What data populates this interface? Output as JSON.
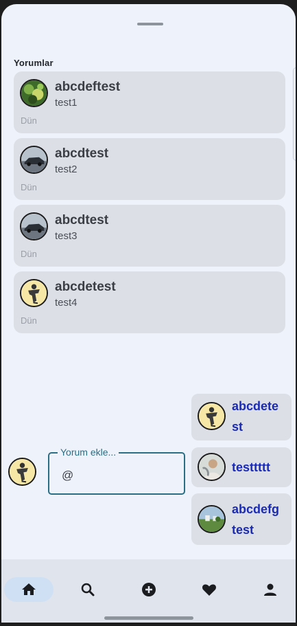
{
  "section_title": "Yorumlar",
  "comments": [
    {
      "user": "abcdeftest",
      "text": "test1",
      "time": "Dün",
      "avatar": "plant-avatar"
    },
    {
      "user": "abcdtest",
      "text": "test2",
      "time": "Dün",
      "avatar": "car-avatar"
    },
    {
      "user": "abcdtest",
      "text": "test3",
      "time": "Dün",
      "avatar": "car-avatar"
    },
    {
      "user": "abcdetest",
      "text": "test4",
      "time": "Dün",
      "avatar": "dancer-avatar"
    }
  ],
  "input": {
    "label": "Yorum ekle...",
    "value": "@"
  },
  "suggestions": [
    {
      "line1": "abcdete",
      "line2": "st",
      "avatar": "dancer-avatar"
    },
    {
      "line1": "testtttt",
      "line2": "",
      "avatar": "person-avatar"
    },
    {
      "line1": "abcdefg",
      "line2": "test",
      "avatar": "landscape-avatar"
    }
  ],
  "nav": [
    {
      "icon": "home-icon",
      "active": true
    },
    {
      "icon": "search-icon",
      "active": false
    },
    {
      "icon": "add-circle-icon",
      "active": false
    },
    {
      "icon": "heart-icon",
      "active": false
    },
    {
      "icon": "profile-icon",
      "active": false
    }
  ],
  "colors": {
    "accent": "#2b6e84",
    "mention": "#1a2bb8",
    "card": "#dcdfe6",
    "background": "#eef2fb"
  }
}
